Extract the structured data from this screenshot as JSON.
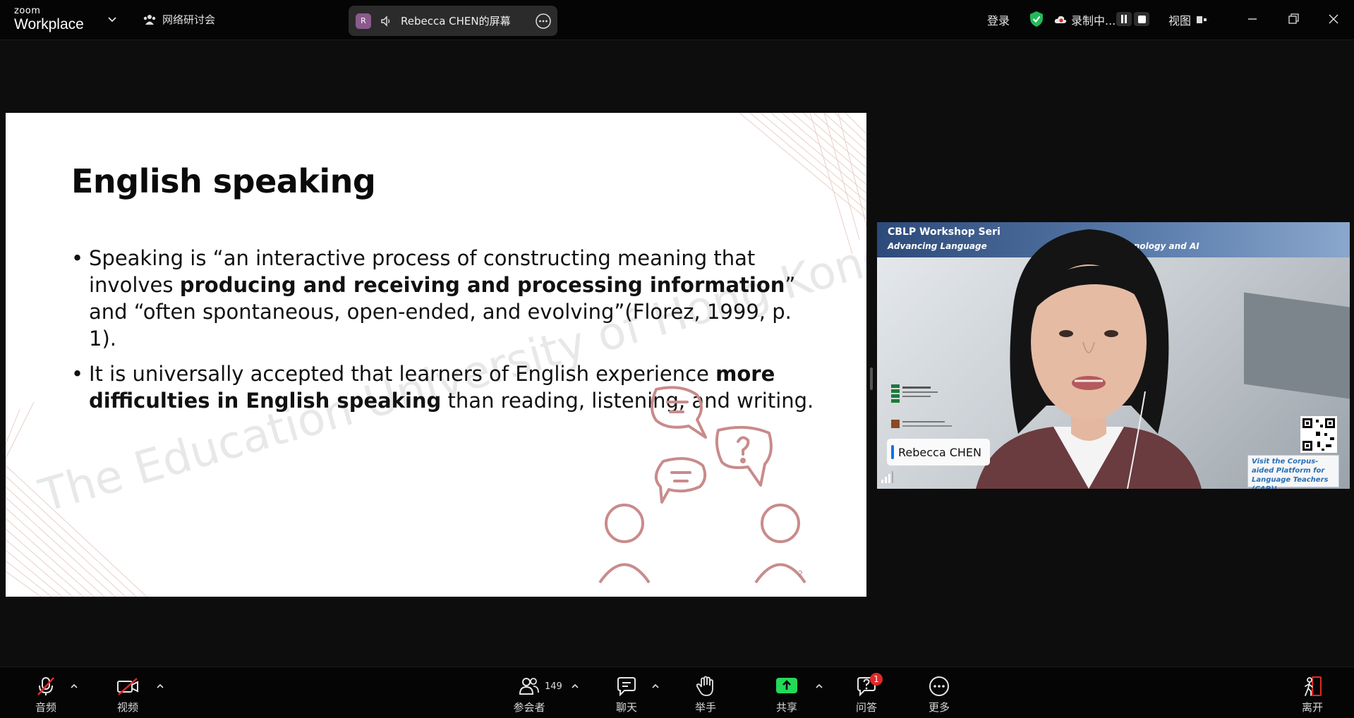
{
  "app": {
    "logo_small": "zoom",
    "logo_big": "Workplace",
    "meeting_title": "网络研讨会",
    "share_label": "Rebecca CHEN的屏幕",
    "share_avatar": "R"
  },
  "topbar_right": {
    "login": "登录",
    "recording": "录制中...",
    "view": "视图"
  },
  "slide": {
    "title": "English speaking",
    "bullet1_a": "Speaking is “an interactive process of constructing meaning that involves ",
    "bullet1_b": "producing and receiving and processing information",
    "bullet1_c": "” and “often spontaneous, open-ended, and evolving”(Florez, 1999, p. 1).",
    "bullet2_a": "It is universally accepted that learners of English experience ",
    "bullet2_b": "more difficulties in English speaking",
    "bullet2_c": " than reading, listening, and writing.",
    "watermark": "The Education University of Hong Kong",
    "page_number": "2",
    "bullet_char": "•"
  },
  "video": {
    "banner_title": "CBLP Workshop Seri",
    "banner_sub_left": "Advancing Language",
    "banner_sub_right": "echnology and AI",
    "cap_text": "Visit the Corpus-aided Platform for Language Teachers (CAP)!",
    "participant_name": "Rebecca CHEN"
  },
  "toolbar": {
    "audio": "音频",
    "video": "视频",
    "participants": "参会者",
    "participants_count": "149",
    "chat": "聊天",
    "raise_hand": "举手",
    "share": "共享",
    "qa": "问答",
    "qa_badge": "1",
    "more": "更多",
    "leave": "离开"
  },
  "colors": {
    "accent_blue": "#0e72ed",
    "share_green": "#23d959",
    "mute_red": "#e02828",
    "security_green": "#23b85b",
    "slide_art": "#c98b8b"
  }
}
